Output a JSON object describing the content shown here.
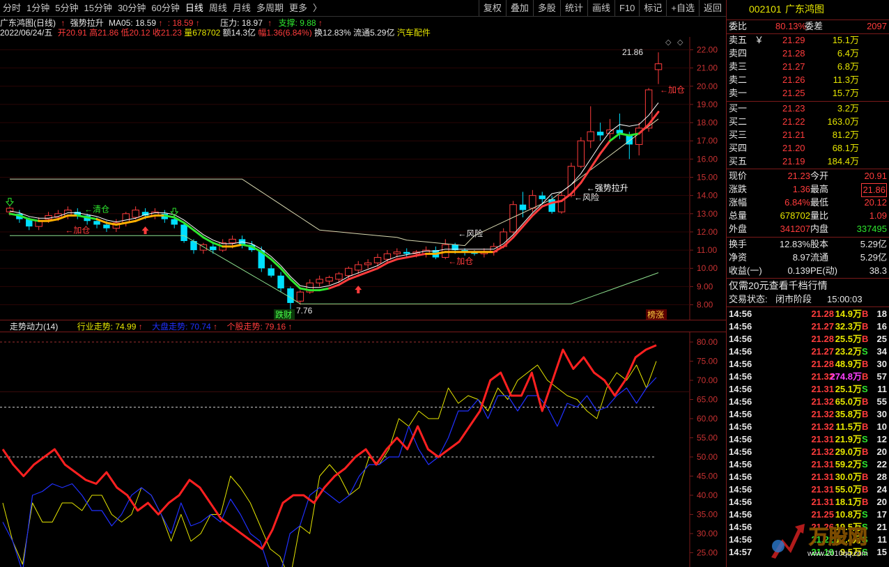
{
  "toolbar": {
    "periods": [
      "分时",
      "1分钟",
      "5分钟",
      "15分钟",
      "30分钟",
      "60分钟",
      "日线",
      "周线",
      "月线",
      "多周期",
      "更多"
    ],
    "more_glyph": "〉",
    "buttons": [
      "复权",
      "叠加",
      "多股",
      "统计",
      "画线",
      "F10",
      "标记",
      "+自选",
      "返回"
    ]
  },
  "info": {
    "name_period": "广东鸿图(日线)",
    "arrow": "↑",
    "indicator": "强势拉升",
    "ma_label": "MA05: 18.59",
    "ma_label2": ": 18.59",
    "pressure": "压力: 18.97",
    "support": "支撑: 9.88",
    "date": "2022/06/24/五",
    "open": "开20.91",
    "high": "高21.86",
    "low": "低20.12",
    "close": "收21.23",
    "vol": "量678702",
    "amt": "额14.3亿",
    "amp": "幅1.36(6.84%)",
    "turn": "换12.83%",
    "float": "流通5.29亿",
    "sector": "汽车配件"
  },
  "chart_annotations": {
    "high_label": "21.86",
    "low_label": "7.76",
    "add_pos": "←加仓",
    "clear_pos": "←清仓",
    "risk": "←风险",
    "strong": "←强势拉升",
    "tag_left": "跌财",
    "tag_right": "榜涨"
  },
  "indicator_panel": {
    "name": "走势动力(14)",
    "industry": "行业走势: 74.99",
    "market": "大盘走势: 70.74",
    "stock": "个股走势: 79.16"
  },
  "colors": {
    "up": "#ff3c3c",
    "down": "#00e0ff",
    "ma": "#ffffff",
    "yellow": "#e6e600",
    "blue": "#2030ff",
    "green": "#2ee62e",
    "grid": "#7a1a1a"
  },
  "chart_data": {
    "type": "candlestick",
    "y_range": [
      7.6,
      22.4
    ],
    "y_ticks": [
      "22.00",
      "21.00",
      "20.00",
      "19.00",
      "18.00",
      "17.00",
      "16.00",
      "15.00",
      "14.00",
      "13.00",
      "12.00",
      "11.00",
      "10.00",
      "9.00",
      "8.00"
    ],
    "candles": [
      [
        13.1,
        13.3,
        12.9,
        13.4
      ],
      [
        13.0,
        12.7,
        12.5,
        13.2
      ],
      [
        12.7,
        12.3,
        12.1,
        12.8
      ],
      [
        12.3,
        12.6,
        12.1,
        12.8
      ],
      [
        12.7,
        12.9,
        12.5,
        13.1
      ],
      [
        12.8,
        13.0,
        12.6,
        13.2
      ],
      [
        12.9,
        13.2,
        12.7,
        13.4
      ],
      [
        13.1,
        12.9,
        12.7,
        13.3
      ],
      [
        12.9,
        12.6,
        12.4,
        13.0
      ],
      [
        12.6,
        12.4,
        12.2,
        12.8
      ],
      [
        12.4,
        12.2,
        12.0,
        12.6
      ],
      [
        12.2,
        12.5,
        12.0,
        12.7
      ],
      [
        12.5,
        13.0,
        12.3,
        13.1
      ],
      [
        12.8,
        13.2,
        12.7,
        13.4
      ],
      [
        13.1,
        12.9,
        12.7,
        13.3
      ],
      [
        12.9,
        13.1,
        12.7,
        13.3
      ],
      [
        13.0,
        12.7,
        12.5,
        13.2
      ],
      [
        12.7,
        12.4,
        12.2,
        12.9
      ],
      [
        12.4,
        11.5,
        11.4,
        12.5
      ],
      [
        11.5,
        11.0,
        10.8,
        11.6
      ],
      [
        11.0,
        11.3,
        10.8,
        11.4
      ],
      [
        11.2,
        11.0,
        10.8,
        11.4
      ],
      [
        11.0,
        11.4,
        10.9,
        11.6
      ],
      [
        11.4,
        11.6,
        11.1,
        11.8
      ],
      [
        11.6,
        11.3,
        11.1,
        11.8
      ],
      [
        11.3,
        11.0,
        10.9,
        11.5
      ],
      [
        11.0,
        10.0,
        9.8,
        11.2
      ],
      [
        10.0,
        9.6,
        9.5,
        10.2
      ],
      [
        9.6,
        8.9,
        8.7,
        9.8
      ],
      [
        8.9,
        8.1,
        7.76,
        9.0
      ],
      [
        8.2,
        8.7,
        8.0,
        8.8
      ],
      [
        8.7,
        9.2,
        8.6,
        9.4
      ],
      [
        9.2,
        9.4,
        9.0,
        9.6
      ],
      [
        9.3,
        9.5,
        9.1,
        9.6
      ],
      [
        9.4,
        9.7,
        9.2,
        9.8
      ],
      [
        9.6,
        10.0,
        9.4,
        10.1
      ],
      [
        9.9,
        10.2,
        9.7,
        10.4
      ],
      [
        10.2,
        10.3,
        10.0,
        10.5
      ],
      [
        10.3,
        10.6,
        10.1,
        10.8
      ],
      [
        10.5,
        10.8,
        10.3,
        11.0
      ],
      [
        10.8,
        10.9,
        10.6,
        11.1
      ],
      [
        10.9,
        10.8,
        10.6,
        11.1
      ],
      [
        10.8,
        10.9,
        10.6,
        11.0
      ],
      [
        10.8,
        11.0,
        10.6,
        11.2
      ],
      [
        11.0,
        10.6,
        10.5,
        11.2
      ],
      [
        10.6,
        11.3,
        10.5,
        11.6
      ],
      [
        11.3,
        11.0,
        10.8,
        11.4
      ],
      [
        11.0,
        10.9,
        10.7,
        11.1
      ],
      [
        10.9,
        10.8,
        10.7,
        11.0
      ],
      [
        10.8,
        10.9,
        10.6,
        11.1
      ],
      [
        10.9,
        11.2,
        10.7,
        11.4
      ],
      [
        11.2,
        12.0,
        11.1,
        12.2
      ],
      [
        12.0,
        13.5,
        11.9,
        13.7
      ],
      [
        13.5,
        13.2,
        12.8,
        14.2
      ],
      [
        13.3,
        14.0,
        13.1,
        14.3
      ],
      [
        14.0,
        13.8,
        13.5,
        14.2
      ],
      [
        13.8,
        13.1,
        13.0,
        14.0
      ],
      [
        13.1,
        14.0,
        13.0,
        14.2
      ],
      [
        14.0,
        15.6,
        13.9,
        15.8
      ],
      [
        15.6,
        17.0,
        15.5,
        17.2
      ],
      [
        17.0,
        17.5,
        16.6,
        18.9
      ],
      [
        17.5,
        17.3,
        17.0,
        18.0
      ],
      [
        17.4,
        17.6,
        17.1,
        18.2
      ],
      [
        17.6,
        17.4,
        17.1,
        18.5
      ],
      [
        17.3,
        16.8,
        16.0,
        17.5
      ],
      [
        16.8,
        17.7,
        16.2,
        18.0
      ],
      [
        17.7,
        19.8,
        17.5,
        19.9
      ],
      [
        20.91,
        21.23,
        20.12,
        21.86
      ]
    ],
    "ma5": [
      13.0,
      12.9,
      12.7,
      12.6,
      12.6,
      12.7,
      12.9,
      12.9,
      12.8,
      12.7,
      12.5,
      12.4,
      12.5,
      12.6,
      12.8,
      12.9,
      12.9,
      12.8,
      12.5,
      12.1,
      11.7,
      11.4,
      11.2,
      11.2,
      11.3,
      11.2,
      10.9,
      10.5,
      10.0,
      9.4,
      8.9,
      8.8,
      8.8,
      8.9,
      9.1,
      9.4,
      9.6,
      9.8,
      10.0,
      10.3,
      10.5,
      10.6,
      10.7,
      10.8,
      10.8,
      10.9,
      10.9,
      10.9,
      10.9,
      10.9,
      10.9,
      11.2,
      11.7,
      12.3,
      12.9,
      13.4,
      13.6,
      13.7,
      14.1,
      14.7,
      15.5,
      16.3,
      17.0,
      17.4,
      17.3,
      17.4,
      17.9,
      18.59
    ],
    "industry_trend": [
      38,
      28,
      22,
      38,
      33,
      33,
      38,
      38,
      36,
      40,
      40,
      35,
      33,
      35,
      42,
      40,
      35,
      28,
      35,
      28,
      30,
      35,
      35,
      45,
      42,
      38,
      32,
      26,
      24,
      18,
      32,
      30,
      45,
      48,
      45,
      40,
      42,
      50,
      48,
      52,
      60,
      58,
      62,
      60,
      60,
      68,
      64,
      66,
      65,
      62,
      68,
      65,
      70,
      72,
      74,
      70,
      68,
      66,
      65,
      62,
      60,
      68,
      72,
      70,
      74,
      68,
      74.99
    ],
    "market_trend": [
      33,
      28,
      20,
      40,
      41,
      43,
      42,
      43,
      40,
      36,
      36,
      32,
      35,
      40,
      42,
      40,
      35,
      30,
      38,
      32,
      33,
      35,
      33,
      39,
      35,
      30,
      28,
      20,
      19,
      30,
      32,
      40,
      42,
      40,
      38,
      40,
      45,
      48,
      48,
      50,
      50,
      58,
      52,
      48,
      50,
      55,
      62,
      62,
      65,
      60,
      66,
      66,
      62,
      66,
      66,
      63,
      58,
      64,
      63,
      66,
      62,
      63,
      66,
      68,
      64,
      68,
      70.74
    ],
    "stock_trend": [
      52,
      48,
      45,
      48,
      50,
      52,
      48,
      46,
      44,
      43,
      46,
      42,
      40,
      36,
      38,
      35,
      38,
      40,
      44,
      42,
      38,
      34,
      32,
      30,
      28,
      26,
      31,
      38,
      40,
      40,
      38,
      42,
      45,
      47,
      50,
      52,
      48,
      52,
      55,
      52,
      58,
      52,
      50,
      52,
      54,
      58,
      62,
      70,
      72,
      66,
      66,
      72,
      62,
      70,
      78,
      73,
      76,
      72,
      70,
      66,
      70,
      76,
      78,
      79.16
    ],
    "ind_y_ticks": [
      "80.00",
      "75.00",
      "70.00",
      "65.00",
      "60.00",
      "55.00",
      "50.00",
      "45.00",
      "40.00",
      "35.00",
      "30.00",
      "25.00"
    ],
    "ind_range": [
      22,
      82
    ]
  },
  "quote": {
    "code": "002101",
    "name": "广东鸿图",
    "wb_label": "委比",
    "wb": "80.13%",
    "wc_label": "委差",
    "wc": "2097",
    "asks": [
      [
        "卖五",
        "￥",
        "21.29",
        "15.1万"
      ],
      [
        "卖四",
        "",
        "21.28",
        "6.4万"
      ],
      [
        "卖三",
        "",
        "21.27",
        "6.8万"
      ],
      [
        "卖二",
        "",
        "21.26",
        "11.3万"
      ],
      [
        "卖一",
        "",
        "21.25",
        "15.7万"
      ]
    ],
    "bids": [
      [
        "买一",
        "21.23",
        "3.2万"
      ],
      [
        "买二",
        "21.22",
        "163.0万"
      ],
      [
        "买三",
        "21.21",
        "81.2万"
      ],
      [
        "买四",
        "21.20",
        "68.1万"
      ],
      [
        "买五",
        "21.19",
        "184.4万"
      ]
    ],
    "stats": [
      [
        "现价",
        "21.23",
        "今开",
        "20.91"
      ],
      [
        "涨跌",
        "1.36",
        "最高",
        "21.86"
      ],
      [
        "涨幅",
        "6.84%",
        "最低",
        "20.12"
      ],
      [
        "总量",
        "678702",
        "量比",
        "1.09"
      ],
      [
        "外盘",
        "341207",
        "内盘",
        "337495"
      ]
    ],
    "stats2": [
      [
        "换手",
        "12.83%",
        "股本",
        "5.29亿"
      ],
      [
        "净资",
        "8.97",
        "流通",
        "5.29亿"
      ],
      [
        "收益(一)",
        "0.139",
        "PE(动)",
        "38.3"
      ]
    ],
    "promo": "仅需20元查看千档行情",
    "status_label": "交易状态:",
    "status": "闭市阶段",
    "status_time": "15:00:03",
    "ticks": [
      [
        "14:56",
        "21.28",
        "14.9万",
        "B",
        "18"
      ],
      [
        "14:56",
        "21.27",
        "32.3万",
        "B",
        "16"
      ],
      [
        "14:56",
        "21.28",
        "25.5万",
        "B",
        "25"
      ],
      [
        "14:56",
        "21.27",
        "23.2万",
        "S",
        "34"
      ],
      [
        "14:56",
        "21.28",
        "48.9万",
        "B",
        "30"
      ],
      [
        "14:56",
        "21.32",
        "274.8万",
        "B",
        "57"
      ],
      [
        "14:56",
        "21.31",
        "25.1万",
        "S",
        "11"
      ],
      [
        "14:56",
        "21.32",
        "65.0万",
        "B",
        "55"
      ],
      [
        "14:56",
        "21.32",
        "35.8万",
        "B",
        "30"
      ],
      [
        "14:56",
        "21.32",
        "11.5万",
        "B",
        "10"
      ],
      [
        "14:56",
        "21.31",
        "21.9万",
        "S",
        "12"
      ],
      [
        "14:56",
        "21.32",
        "29.0万",
        "B",
        "20"
      ],
      [
        "14:56",
        "21.31",
        "59.2万",
        "S",
        "22"
      ],
      [
        "14:56",
        "21.31",
        "30.0万",
        "B",
        "28"
      ],
      [
        "14:56",
        "21.31",
        "55.0万",
        "B",
        "24"
      ],
      [
        "14:56",
        "21.31",
        "18.1万",
        "B",
        "20"
      ],
      [
        "14:56",
        "21.25",
        "10.8万",
        "S",
        "17"
      ],
      [
        "14:56",
        "21.26",
        "19.5万",
        "S",
        "21"
      ],
      [
        "14:56",
        "21.22",
        "12.4万",
        "S",
        "11"
      ],
      [
        "14:57",
        "21.19",
        "9.5万",
        "S",
        "15"
      ]
    ],
    "watermark": "万股网",
    "watermark_url": "www.2010qq.com"
  }
}
